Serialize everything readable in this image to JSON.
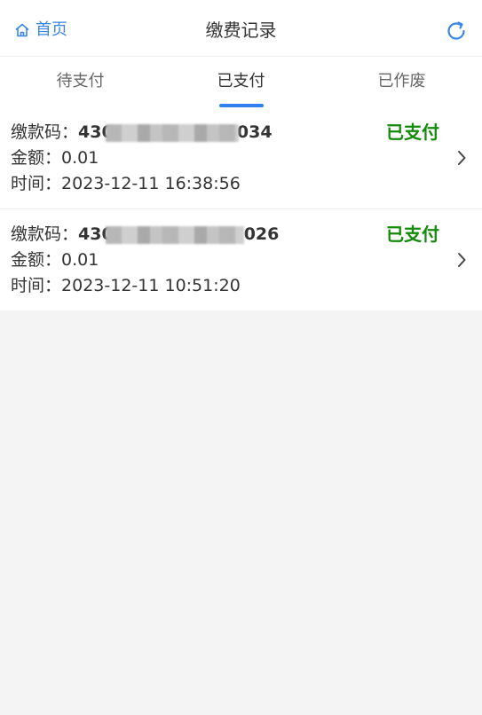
{
  "header": {
    "home_label": "首页",
    "title": "缴费记录",
    "home_icon": "home-icon",
    "refresh_icon": "refresh-icon",
    "accent_color": "#3a86e6"
  },
  "tabs": [
    {
      "label": "待支付",
      "active": false
    },
    {
      "label": "已支付",
      "active": true
    },
    {
      "label": "已作废",
      "active": false
    }
  ],
  "records": [
    {
      "code_label": "缴款码：",
      "code_prefix": "430",
      "code_suffix": "0034",
      "amount_label": "金额：",
      "amount": "0.01",
      "time_label": "时间：",
      "time": "2023-12-11 16:38:56",
      "status": "已支付"
    },
    {
      "code_label": "缴款码：",
      "code_prefix": "430",
      "code_suffix": "026",
      "amount_label": "金额：",
      "amount": "0.01",
      "time_label": "时间：",
      "time": "2023-12-11 10:51:20",
      "status": "已支付"
    }
  ],
  "colors": {
    "status_paid": "#148a0b",
    "tab_indicator": "#2f80ed",
    "page_background": "#f4f4f4"
  }
}
